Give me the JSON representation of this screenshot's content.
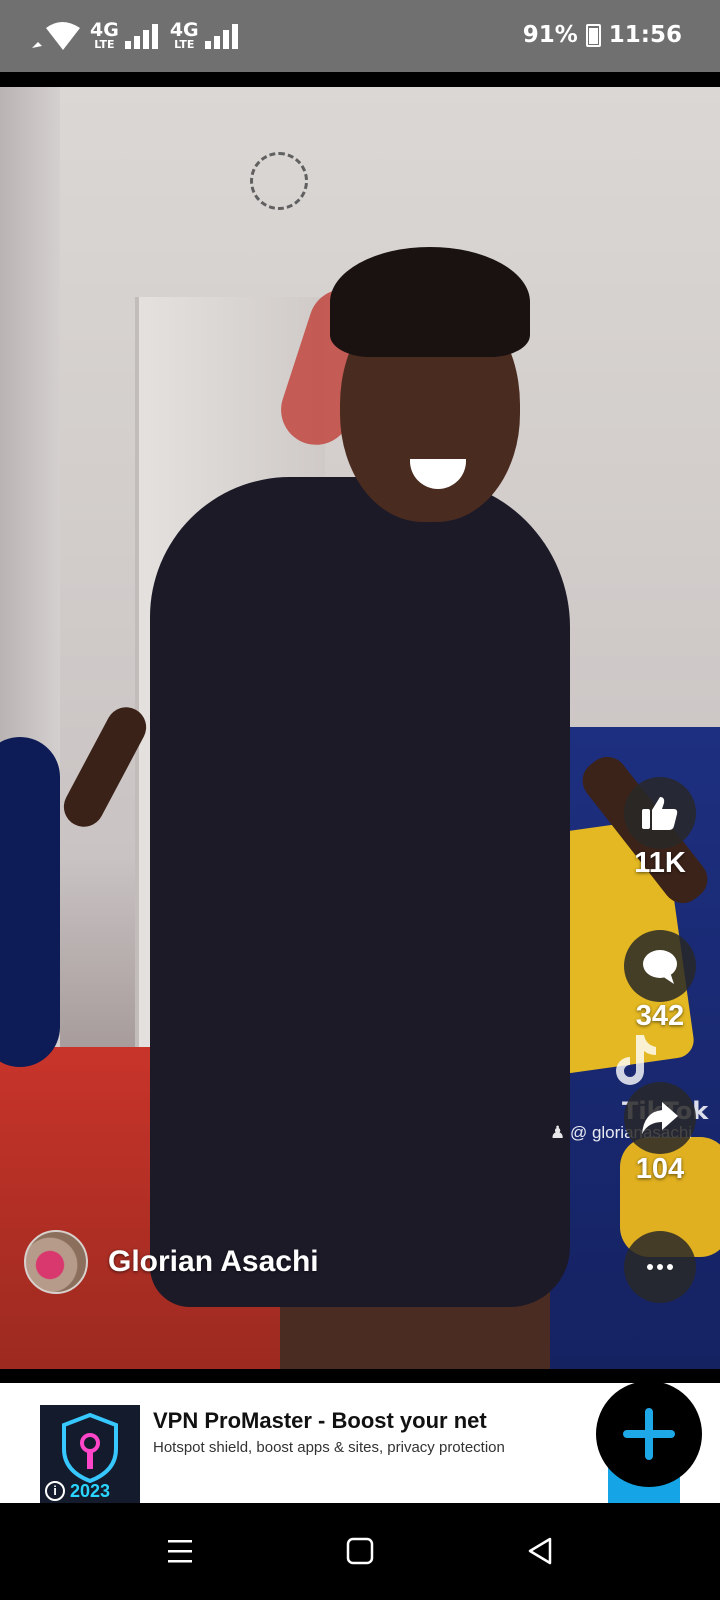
{
  "status_bar": {
    "network_1": "4G",
    "network_1_sub": "LTE",
    "network_2": "4G",
    "network_2_sub": "LTE",
    "battery": "91%",
    "time": "11:56"
  },
  "video": {
    "watermark_app": "TikTok",
    "watermark_handle": "@ glorianasachi"
  },
  "actions": {
    "like_count": "11K",
    "comment_count": "342",
    "share_count": "104",
    "like_icon": "thumbs-up-icon",
    "comment_icon": "comment-bubble-icon",
    "share_icon": "share-arrow-icon",
    "more_icon": "more-dots-icon"
  },
  "creator": {
    "name": "Glorian Asachi"
  },
  "ad": {
    "title": "VPN ProMaster - Boost your net",
    "subtitle": "Hotspot shield, boost apps & sites, privacy protection",
    "icon_year": "2023",
    "info_label": "i"
  },
  "colors": {
    "status_bar": "#707070",
    "ad_cta": "#15a5e6",
    "fab_plus": "#1ea8e8",
    "ad_year": "#2ad5ff"
  }
}
